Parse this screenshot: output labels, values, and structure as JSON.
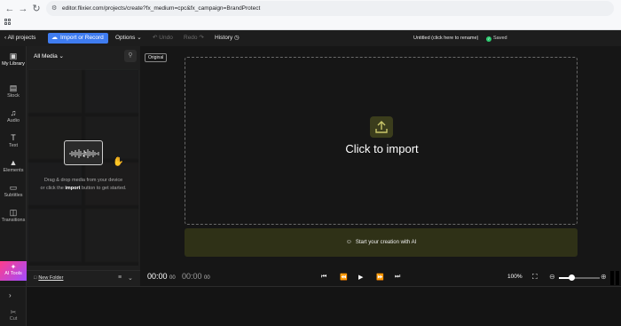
{
  "browser": {
    "url": "editor.flixier.com/projects/create?fx_medium=cpc&fx_campaign=BrandProtect",
    "icons": [
      "back-icon",
      "forward-icon",
      "reload-icon",
      "site-info-icon",
      "apps-grid-icon"
    ]
  },
  "topbar": {
    "back_label": "All projects",
    "import_label": "Import or Record",
    "options_label": "Options",
    "undo_label": "Undo",
    "redo_label": "Redo",
    "history_label": "History",
    "project_title": "Untitled (click here to rename)",
    "saved_label": "Saved"
  },
  "leftnav": {
    "items": [
      {
        "label": "My Library",
        "icon": "folder-icon"
      },
      {
        "label": "Stock",
        "icon": "film-icon"
      },
      {
        "label": "Audio",
        "icon": "music-note-icon"
      },
      {
        "label": "Text",
        "icon": "text-icon"
      },
      {
        "label": "Elements",
        "icon": "shapes-icon"
      },
      {
        "label": "Subtitles",
        "icon": "cc-icon"
      },
      {
        "label": "Transitions",
        "icon": "transition-icon"
      }
    ],
    "ai_tools_label": "AI Tools"
  },
  "library": {
    "title": "All Media",
    "drop_text_1": "Drag & drop media from your device",
    "drop_text_2a": "or click the ",
    "drop_text_2b": "import",
    "drop_text_2c": " button to get started.",
    "new_folder_label": "New Folder"
  },
  "editor": {
    "original_label": "Original",
    "click_to_import": "Click to import",
    "ai_cta": "Start your creation with AI",
    "current_time": "00:00",
    "current_frames": "00",
    "total_time": "00:00",
    "total_frames": "00",
    "zoom_level": "100%",
    "zoom_slider_fraction": 0.3
  },
  "timeline": {
    "cut_label": "Cut"
  },
  "colors": {
    "accent_blue": "#3f7cf0",
    "saved_green": "#2ecc71",
    "ai_bar": "#2f3117",
    "ai_tools_gradient": [
      "#ff3d8b",
      "#a14cff"
    ]
  }
}
